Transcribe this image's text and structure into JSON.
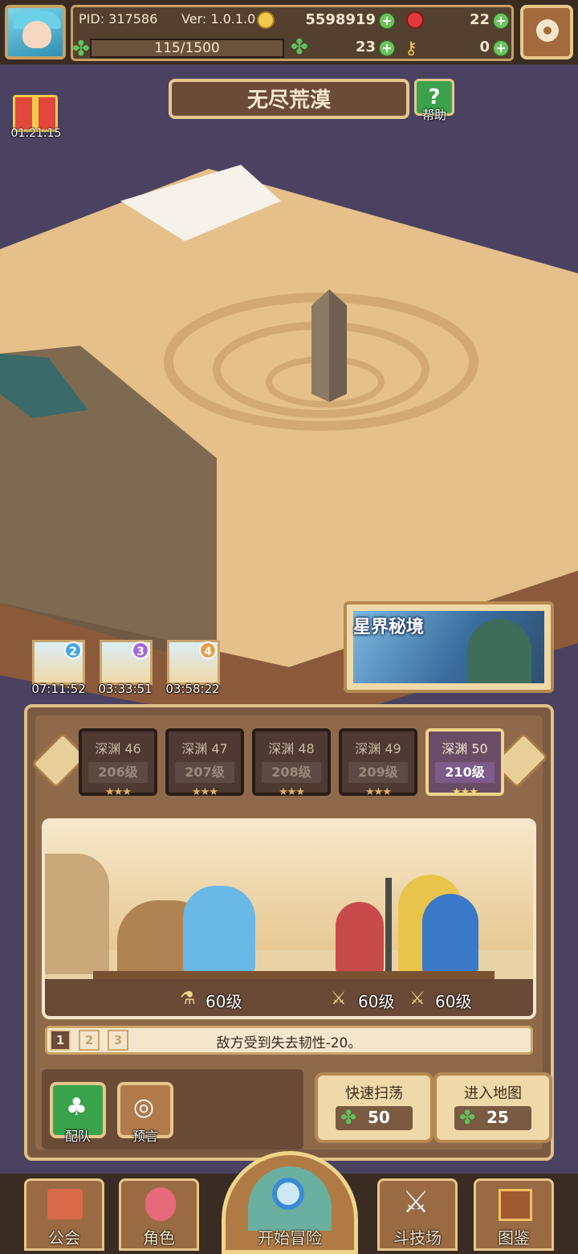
{
  "header": {
    "pid": "PID: 317586",
    "version": "Ver: 1.0.1.0",
    "gold": "5598919",
    "gems": "22",
    "clover": "23",
    "keys": "0",
    "energy": "115/1500"
  },
  "map": {
    "title": "无尽荒漠",
    "help_label": "帮助",
    "gift_timer": "01:21:15"
  },
  "expeditions": [
    {
      "num": "2",
      "time": "07:11:52",
      "color": "#4aa6e6"
    },
    {
      "num": "3",
      "time": "03:33:51",
      "color": "#a36bd6"
    },
    {
      "num": "4",
      "time": "03:58:22",
      "color": "#e6a04a"
    }
  ],
  "astral": {
    "title": "星界秘境"
  },
  "stages": [
    {
      "name": "深渊 46",
      "level": "206级",
      "stars": "★★★"
    },
    {
      "name": "深渊 47",
      "level": "207级",
      "stars": "★★★"
    },
    {
      "name": "深渊 48",
      "level": "208级",
      "stars": "★★★"
    },
    {
      "name": "深渊 49",
      "level": "209级",
      "stars": "★★★"
    },
    {
      "name": "深渊 50",
      "level": "210级",
      "stars": "★★★",
      "selected": true
    }
  ],
  "battle": {
    "party_levels": [
      "60级",
      "60级",
      "60级"
    ],
    "effect_text": "敌方受到失去韧性-20。",
    "pages": [
      "1",
      "2",
      "3"
    ],
    "current_page": "1"
  },
  "actions": {
    "team_label": "配队",
    "prophecy_label": "预言",
    "sweep_label": "快速扫荡",
    "sweep_cost": "50",
    "enter_label": "进入地图",
    "enter_cost": "25"
  },
  "nav": {
    "guild": "公会",
    "character": "角色",
    "adventure": "开始冒险",
    "arena": "斗技场",
    "codex": "图鉴"
  }
}
